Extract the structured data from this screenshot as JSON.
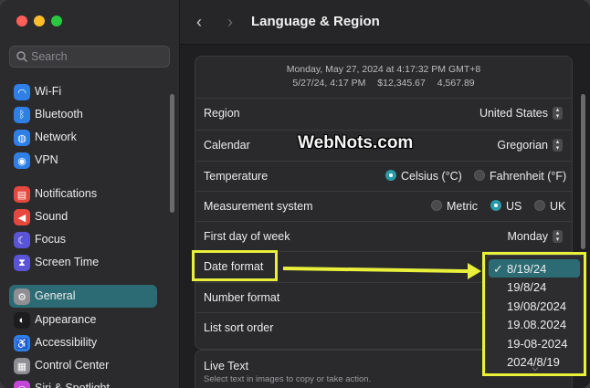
{
  "window": {
    "title": "Language & Region"
  },
  "sidebar": {
    "search_placeholder": "Search",
    "items": [
      {
        "label": "Wi-Fi",
        "icon": "wifi-icon",
        "color": "#2f7fe6",
        "glyph": "◠"
      },
      {
        "label": "Bluetooth",
        "icon": "bluetooth-icon",
        "color": "#2f7fe6",
        "glyph": "ᛒ"
      },
      {
        "label": "Network",
        "icon": "globe-icon",
        "color": "#2f7fe6",
        "glyph": "◍"
      },
      {
        "label": "VPN",
        "icon": "vpn-icon",
        "color": "#2f7fe6",
        "glyph": "◉"
      },
      {
        "label": "Notifications",
        "icon": "bell-icon",
        "color": "#e5483f",
        "glyph": "▤"
      },
      {
        "label": "Sound",
        "icon": "speaker-icon",
        "color": "#e5483f",
        "glyph": "◀"
      },
      {
        "label": "Focus",
        "icon": "moon-icon",
        "color": "#5b55d6",
        "glyph": "☾"
      },
      {
        "label": "Screen Time",
        "icon": "hourglass-icon",
        "color": "#5b55d6",
        "glyph": "⧗"
      },
      {
        "label": "General",
        "icon": "gear-icon",
        "color": "#8e8e93",
        "glyph": "⚙"
      },
      {
        "label": "Appearance",
        "icon": "appearance-icon",
        "color": "#1c1c1e",
        "glyph": "◐"
      },
      {
        "label": "Accessibility",
        "icon": "accessibility-icon",
        "color": "#2f7fe6",
        "glyph": "♿"
      },
      {
        "label": "Control Center",
        "icon": "control-center-icon",
        "color": "#8e8e93",
        "glyph": "▦"
      },
      {
        "label": "Siri & Spotlight",
        "icon": "siri-icon",
        "color": "#c447d9",
        "glyph": "◎"
      }
    ],
    "active_index": 8
  },
  "preview": {
    "line1": "Monday, May 27, 2024 at 4:17:32 PM GMT+8",
    "date": "5/27/24, 4:17 PM",
    "currency": "$12,345.67",
    "number": "4,567.89"
  },
  "settings": {
    "region": {
      "label": "Region",
      "value": "United States"
    },
    "calendar": {
      "label": "Calendar",
      "value": "Gregorian"
    },
    "temperature": {
      "label": "Temperature",
      "option1": "Celsius (°C)",
      "option2": "Fahrenheit (°F)",
      "selected": "Celsius (°C)"
    },
    "measurement": {
      "label": "Measurement system",
      "option1": "Metric",
      "option2": "US",
      "option3": "UK",
      "selected": "US"
    },
    "first_day": {
      "label": "First day of week",
      "value": "Monday"
    },
    "date_format": {
      "label": "Date format"
    },
    "number_format": {
      "label": "Number format"
    },
    "list_sort": {
      "label": "List sort order"
    }
  },
  "live_text": {
    "title": "Live Text",
    "subtitle": "Select text in images to copy or take action."
  },
  "dropdown": {
    "options": [
      "8/19/24",
      "19/8/24",
      "19/08/2024",
      "19.08.2024",
      "19-08-2024",
      "2024/8/19"
    ],
    "selected_index": 0,
    "checkmark": "✓"
  },
  "watermark": "WebNots.com",
  "annotation_color": "#e8f03a"
}
